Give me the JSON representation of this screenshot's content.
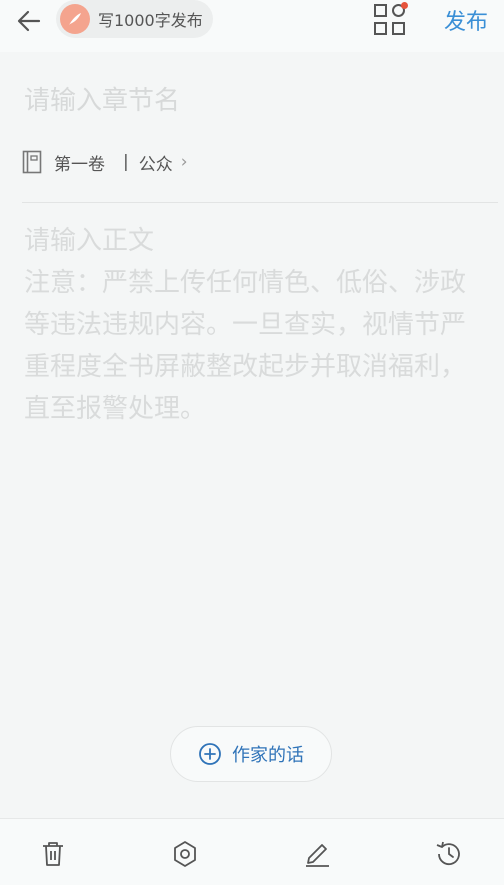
{
  "header": {
    "task_chip_label": "写1000字发布",
    "publish_label": "发布"
  },
  "editor": {
    "chapter_title_placeholder": "请输入章节名",
    "volume_name": "第一卷",
    "volume_visibility": "公众",
    "body_placeholder_line1": "请输入正文",
    "body_placeholder_note": "注意：严禁上传任何情色、低俗、涉政等违法违规内容。一旦查实，视情节严重程度全书屏蔽整改起步并取消福利，直至报警处理。"
  },
  "author_note_button_label": "作家的话",
  "bottom_toolbar": [
    "trash-icon",
    "settings-hex-icon",
    "pen-icon",
    "history-icon"
  ],
  "colors": {
    "accent": "#3a8fd6",
    "badge": "#e6533b",
    "chip_icon": "#f4a48e"
  }
}
